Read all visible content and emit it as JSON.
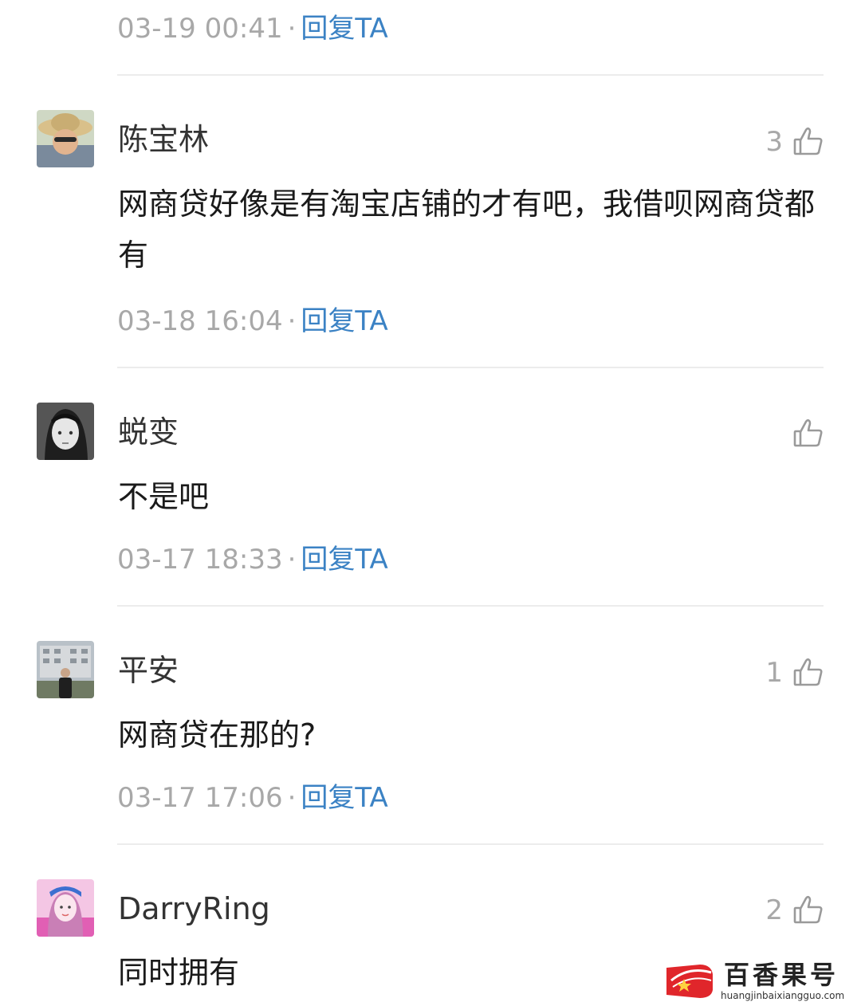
{
  "top_comment": {
    "time": "03-19 00:41",
    "reply_label": "回复TA"
  },
  "separator": "·",
  "comments": [
    {
      "username": "陈宝林",
      "content": "网商贷好像是有淘宝店铺的才有吧，我借呗网商贷都有",
      "time": "03-18 16:04",
      "reply_label": "回复TA",
      "likes": "3"
    },
    {
      "username": "蜕变",
      "content": "不是吧",
      "time": "03-17 18:33",
      "reply_label": "回复TA",
      "likes": ""
    },
    {
      "username": "平安",
      "content": "网商贷在那的?",
      "time": "03-17 17:06",
      "reply_label": "回复TA",
      "likes": "1"
    },
    {
      "username": "DarryRing",
      "content": "同时拥有",
      "likes": "2"
    }
  ],
  "watermark": {
    "title": "百香果号",
    "url": "huangjinbaixiangguo.com"
  },
  "icons": {
    "like": "thumbs-up-icon",
    "watermark_logo": "star-logo-icon"
  },
  "colors": {
    "reply_link": "#3b82c4",
    "meta_text": "#a8a8a8",
    "logo_red": "#e0262b"
  }
}
